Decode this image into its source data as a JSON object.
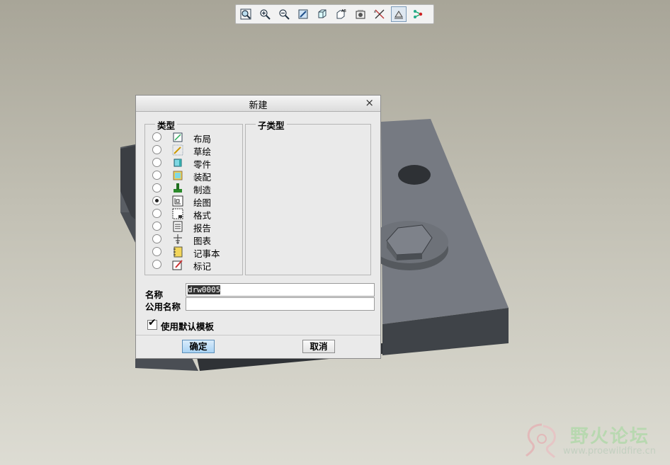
{
  "toolbar": {
    "buttons": [
      {
        "name": "zoom-fit-icon"
      },
      {
        "name": "zoom-in-icon"
      },
      {
        "name": "zoom-out-icon"
      },
      {
        "name": "repaint-icon"
      },
      {
        "name": "display-style-icon"
      },
      {
        "name": "saved-views-icon"
      },
      {
        "name": "layers-icon"
      },
      {
        "name": "datum-display-icon"
      },
      {
        "name": "annotation-display-icon"
      },
      {
        "name": "spin-center-icon"
      }
    ]
  },
  "dialog": {
    "title": "新建",
    "close_symbol": "×",
    "type_group_label": "类型",
    "subtype_group_label": "子类型",
    "types": [
      {
        "label": "布局",
        "icon": "layout-icon",
        "selected": false
      },
      {
        "label": "草绘",
        "icon": "sketch-icon",
        "selected": false
      },
      {
        "label": "零件",
        "icon": "part-icon",
        "selected": false
      },
      {
        "label": "装配",
        "icon": "assembly-icon",
        "selected": false
      },
      {
        "label": "制造",
        "icon": "manufacturing-icon",
        "selected": false
      },
      {
        "label": "绘图",
        "icon": "drawing-icon",
        "selected": true
      },
      {
        "label": "格式",
        "icon": "format-icon",
        "selected": false
      },
      {
        "label": "报告",
        "icon": "report-icon",
        "selected": false
      },
      {
        "label": "图表",
        "icon": "diagram-icon",
        "selected": false
      },
      {
        "label": "记事本",
        "icon": "notebook-icon",
        "selected": false
      },
      {
        "label": "标记",
        "icon": "markup-icon",
        "selected": false
      }
    ],
    "name_label": "名称",
    "name_value": "drw0005",
    "common_name_label": "公用名称",
    "common_name_value": "",
    "use_default_template_label": "使用默认模板",
    "use_default_template_checked": true,
    "ok_label": "确定",
    "cancel_label": "取消"
  },
  "watermark": {
    "title": "野火论坛",
    "url": "www.proewildfire.cn"
  }
}
